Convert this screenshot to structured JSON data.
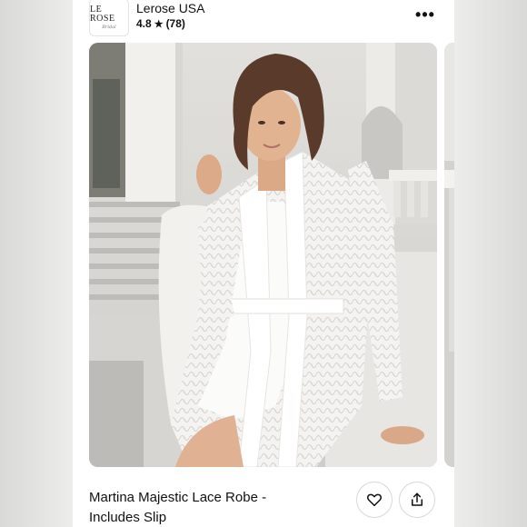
{
  "store": {
    "logo_text": "LE ROSE",
    "logo_subtext": "Bridal",
    "name": "Lerose USA",
    "rating": "4.8",
    "review_count": "(78)",
    "star_icon": "star-icon",
    "more_icon": "more-options-icon"
  },
  "product": {
    "title": "Martina Majestic Lace Robe - Includes Slip",
    "image_alt": "Woman seated on white steps wearing a white lace robe over a white slip"
  },
  "actions": {
    "like_icon": "heart-icon",
    "share_icon": "share-icon"
  }
}
